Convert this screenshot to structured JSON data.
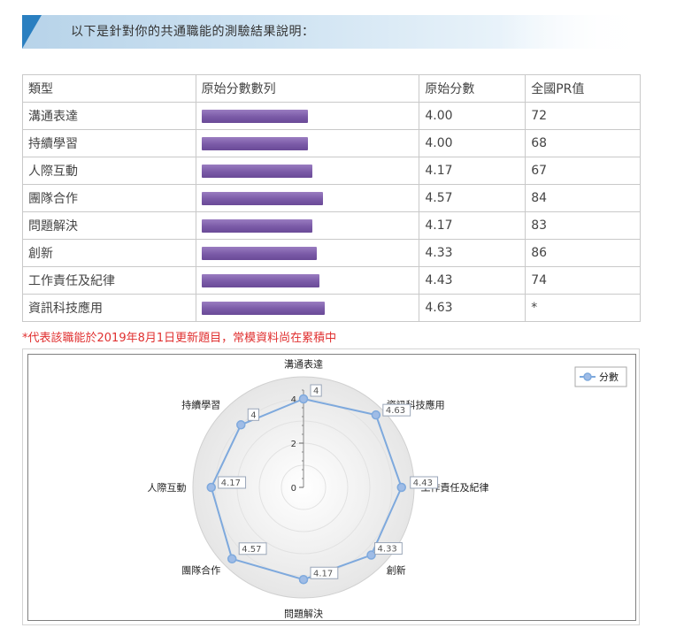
{
  "header": {
    "title": "以下是針對你的共通職能的測驗結果說明："
  },
  "table": {
    "headers": [
      "類型",
      "原始分數數列",
      "原始分數",
      "全國PR值"
    ],
    "rows": [
      {
        "type": "溝通表達",
        "score": "4.00",
        "pr": "72"
      },
      {
        "type": "持續學習",
        "score": "4.00",
        "pr": "68"
      },
      {
        "type": "人際互動",
        "score": "4.17",
        "pr": "67"
      },
      {
        "type": "團隊合作",
        "score": "4.57",
        "pr": "84"
      },
      {
        "type": "問題解決",
        "score": "4.17",
        "pr": "83"
      },
      {
        "type": "創新",
        "score": "4.33",
        "pr": "86"
      },
      {
        "type": "工作責任及紀律",
        "score": "4.43",
        "pr": "74"
      },
      {
        "type": "資訊科技應用",
        "score": "4.63",
        "pr": "*"
      }
    ]
  },
  "footnote": "*代表該職能於2019年8月1日更新題目，常模資料尚在累積中",
  "chart_data": {
    "type": "radar",
    "categories": [
      "溝通表達",
      "資訊科技應用",
      "工作責任及紀律",
      "創新",
      "問題解決",
      "團隊合作",
      "人際互動",
      "持續學習"
    ],
    "series": [
      {
        "name": "分數",
        "values": [
          4,
          4.63,
          4.43,
          4.33,
          4.17,
          4.57,
          4.17,
          4
        ],
        "labels": [
          "4",
          "4.63",
          "4.43",
          "4.33",
          "4.17",
          "4.57",
          "4.17",
          "4"
        ],
        "color": "#7ea9dd"
      }
    ],
    "radial_ticks": [
      "0",
      "2",
      "4"
    ],
    "range": [
      0,
      5
    ],
    "legend": "top-right",
    "grid": true
  }
}
